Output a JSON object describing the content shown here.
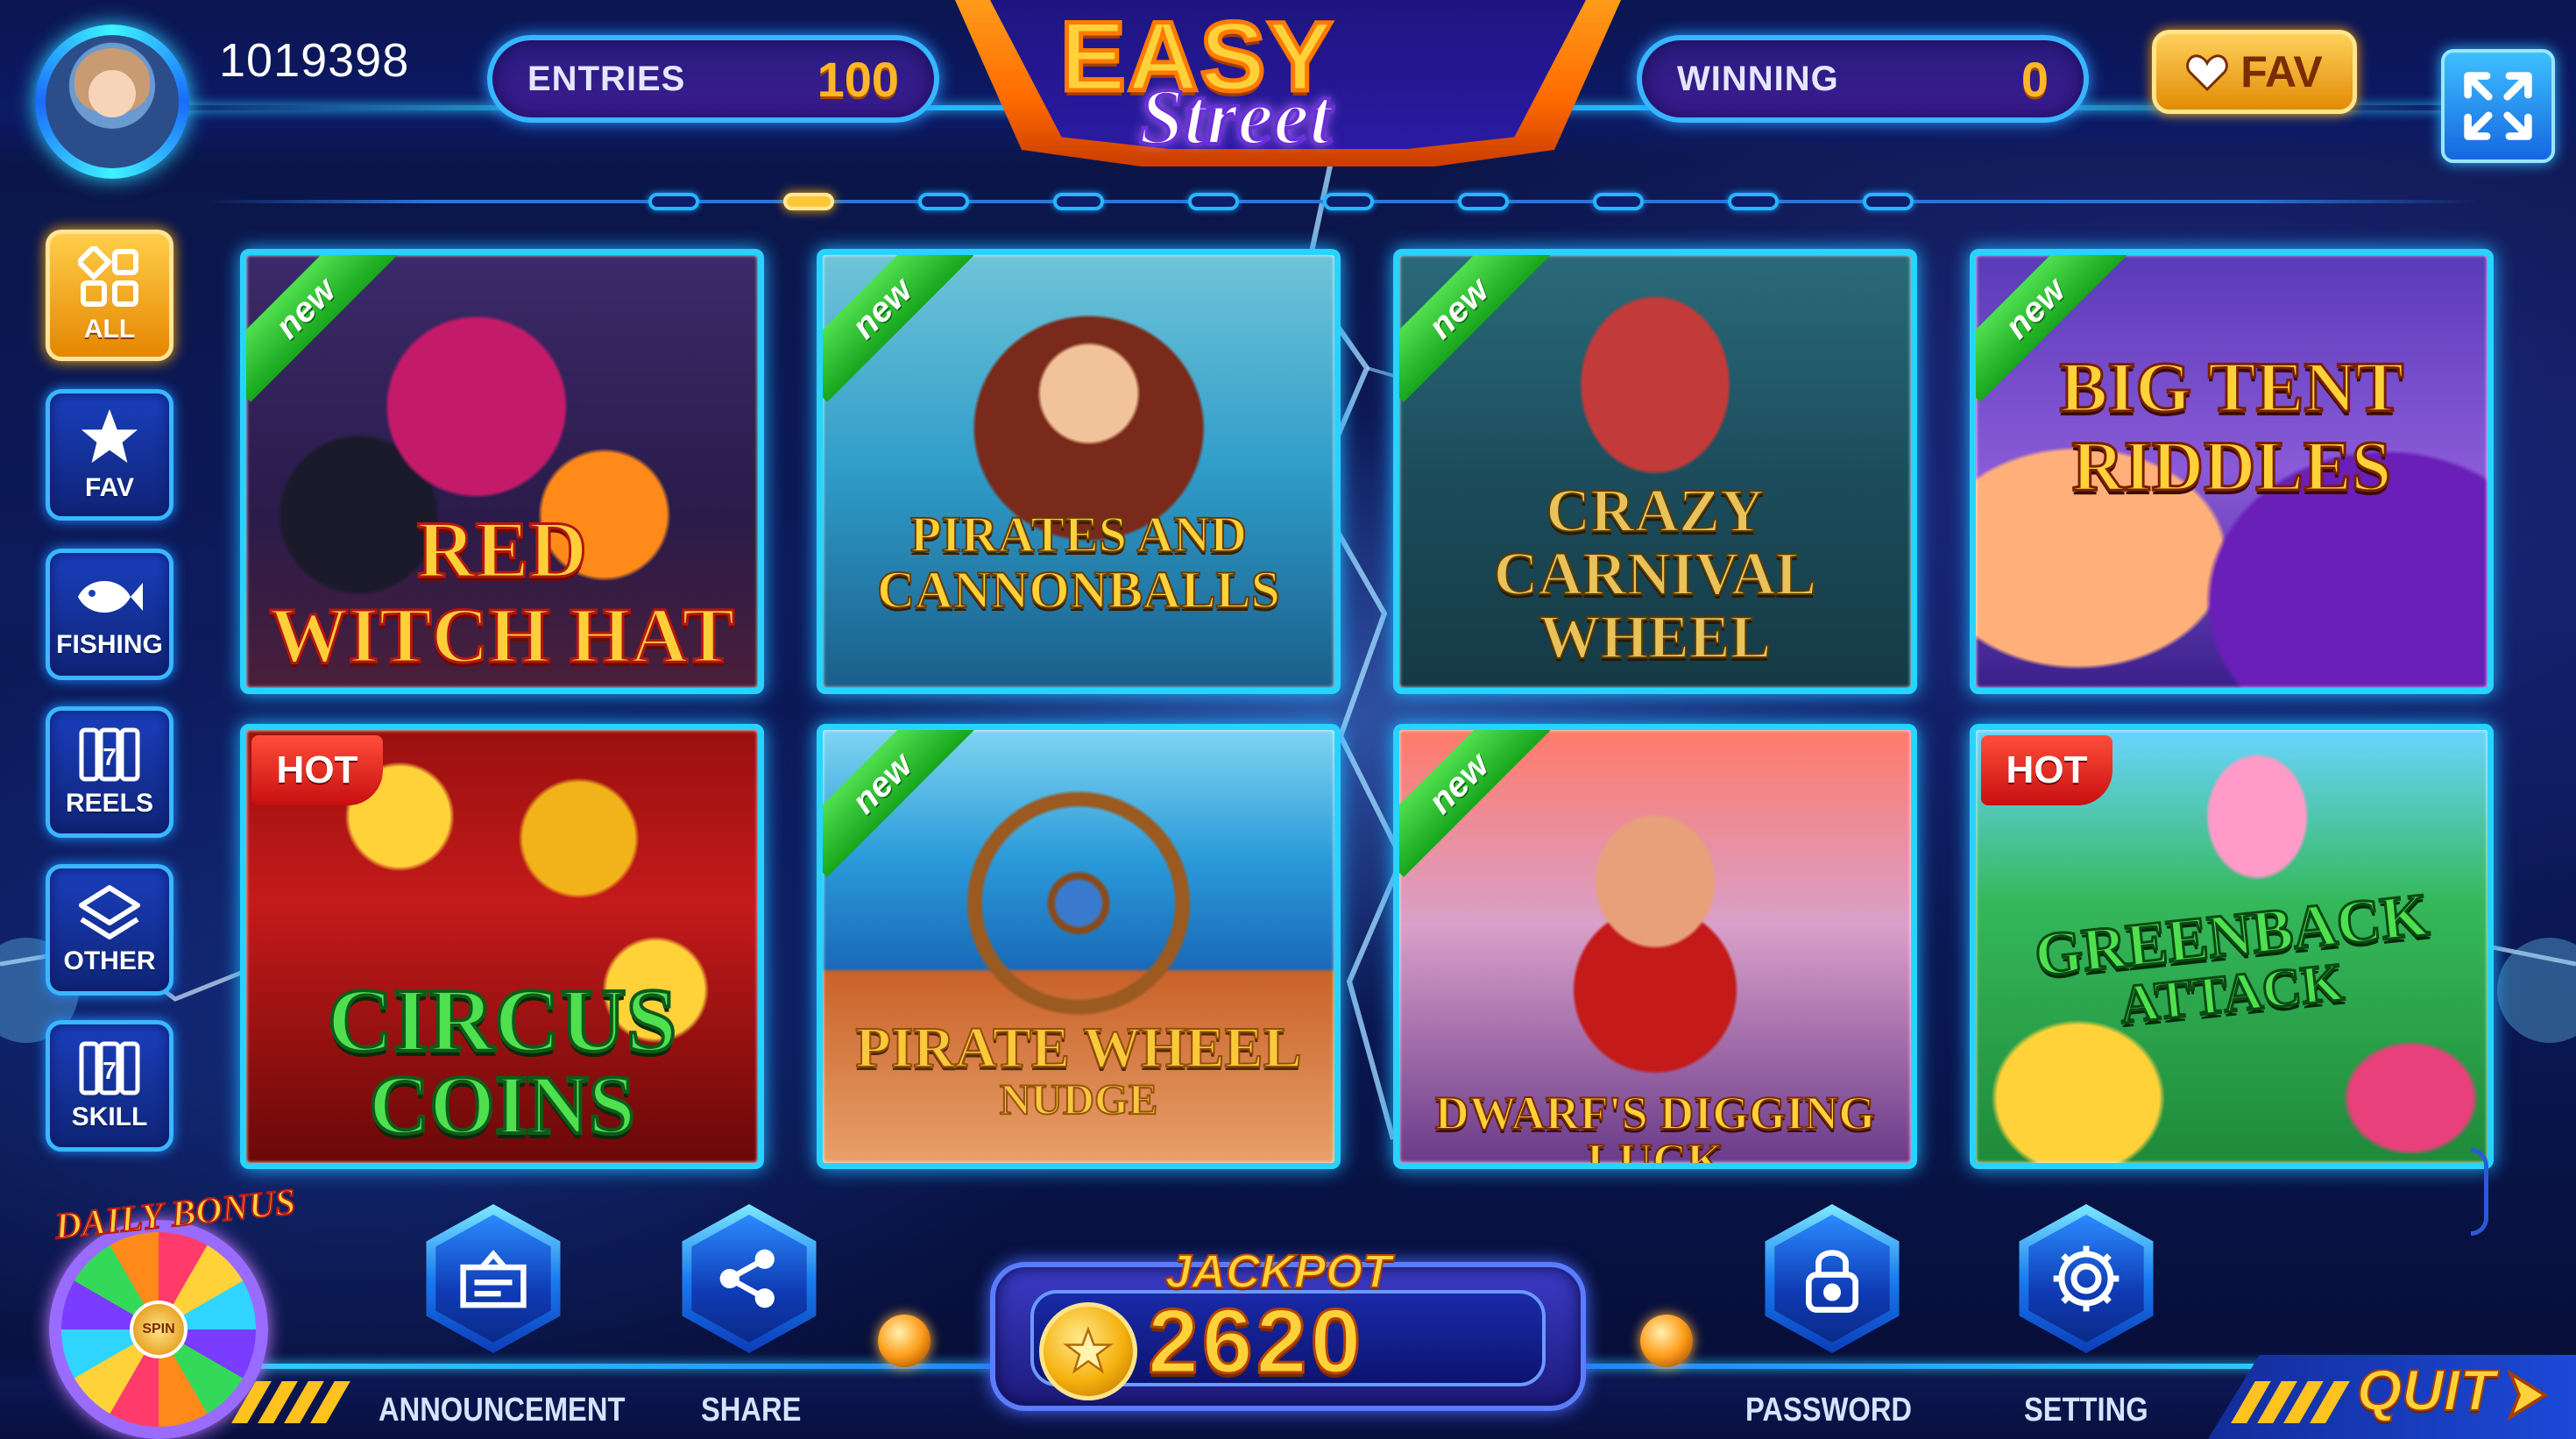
{
  "header": {
    "user_id": "1019398",
    "entries_label": "ENTRIES",
    "entries_value": "100",
    "winning_label": "WINNING",
    "winning_value": "0",
    "logo_line1": "EASY",
    "logo_line2": "Street",
    "fav_label": "FAV",
    "fullscreen_icon": "expand-icon"
  },
  "pager": {
    "count": 10,
    "active_index": 1
  },
  "sidebar": {
    "items": [
      {
        "label": "ALL",
        "icon": "grid-icon",
        "active": true
      },
      {
        "label": "FAV",
        "icon": "star-icon",
        "active": false
      },
      {
        "label": "FISHING",
        "icon": "fish-icon",
        "active": false
      },
      {
        "label": "REELS",
        "icon": "slot-reel-icon",
        "active": false
      },
      {
        "label": "OTHER",
        "icon": "layers-icon",
        "active": false
      },
      {
        "label": "SKILL",
        "icon": "slot-reel-icon",
        "active": false
      }
    ]
  },
  "games": [
    {
      "title_l1": "RED",
      "title_l2": "WITCH HAT",
      "tag": "new"
    },
    {
      "title_l1": "PIRATES AND",
      "title_l2": "CANNONBALLS",
      "tag": "new"
    },
    {
      "title_l1": "CRAZY",
      "title_l2": "CARNIVAL",
      "title_l3": "WHEEL",
      "tag": "new"
    },
    {
      "title_l1": "BIG TENT",
      "title_l2": "RIDDLES",
      "tag": "new"
    },
    {
      "title_l1": "CIRCUS",
      "title_l2": "COINS",
      "tag": "HOT"
    },
    {
      "title_l1": "PIRATE WHEEL",
      "title_l2": "NUDGE",
      "tag": "new"
    },
    {
      "title_l1": "DWARF'S DIGGING LUCK",
      "tag": "new"
    },
    {
      "title_l1": "GREENBACK",
      "title_l2": "ATTACK",
      "tag": "HOT"
    }
  ],
  "bottom": {
    "daily_bonus_label": "DAILY BONUS",
    "spin_label": "SPIN",
    "announcement_label": "ANNOUNCEMENT",
    "share_label": "SHARE",
    "jackpot_label": "JACKPOT",
    "jackpot_value": "2620",
    "password_label": "PASSWORD",
    "setting_label": "SETTING",
    "quit_label": "QUIT"
  }
}
